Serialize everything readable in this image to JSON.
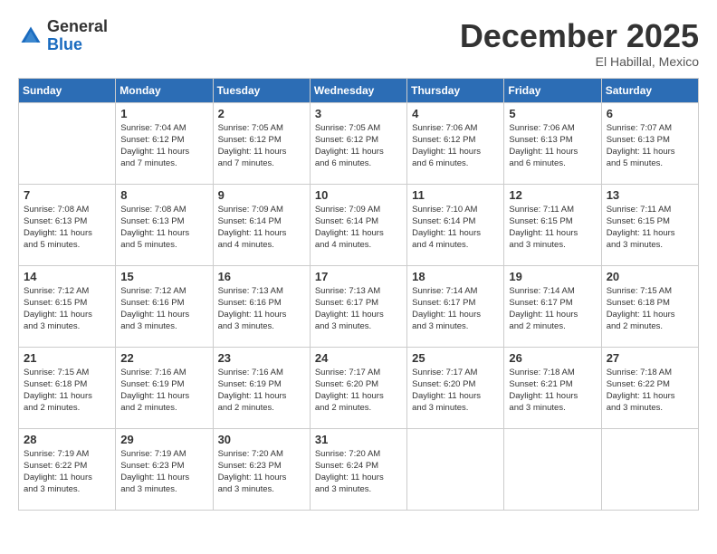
{
  "logo": {
    "general": "General",
    "blue": "Blue"
  },
  "title": "December 2025",
  "location": "El Habillal, Mexico",
  "days": [
    "Sunday",
    "Monday",
    "Tuesday",
    "Wednesday",
    "Thursday",
    "Friday",
    "Saturday"
  ],
  "weeks": [
    [
      {
        "num": "",
        "info": ""
      },
      {
        "num": "1",
        "info": "Sunrise: 7:04 AM\nSunset: 6:12 PM\nDaylight: 11 hours\nand 7 minutes."
      },
      {
        "num": "2",
        "info": "Sunrise: 7:05 AM\nSunset: 6:12 PM\nDaylight: 11 hours\nand 7 minutes."
      },
      {
        "num": "3",
        "info": "Sunrise: 7:05 AM\nSunset: 6:12 PM\nDaylight: 11 hours\nand 6 minutes."
      },
      {
        "num": "4",
        "info": "Sunrise: 7:06 AM\nSunset: 6:12 PM\nDaylight: 11 hours\nand 6 minutes."
      },
      {
        "num": "5",
        "info": "Sunrise: 7:06 AM\nSunset: 6:13 PM\nDaylight: 11 hours\nand 6 minutes."
      },
      {
        "num": "6",
        "info": "Sunrise: 7:07 AM\nSunset: 6:13 PM\nDaylight: 11 hours\nand 5 minutes."
      }
    ],
    [
      {
        "num": "7",
        "info": "Sunrise: 7:08 AM\nSunset: 6:13 PM\nDaylight: 11 hours\nand 5 minutes."
      },
      {
        "num": "8",
        "info": "Sunrise: 7:08 AM\nSunset: 6:13 PM\nDaylight: 11 hours\nand 5 minutes."
      },
      {
        "num": "9",
        "info": "Sunrise: 7:09 AM\nSunset: 6:14 PM\nDaylight: 11 hours\nand 4 minutes."
      },
      {
        "num": "10",
        "info": "Sunrise: 7:09 AM\nSunset: 6:14 PM\nDaylight: 11 hours\nand 4 minutes."
      },
      {
        "num": "11",
        "info": "Sunrise: 7:10 AM\nSunset: 6:14 PM\nDaylight: 11 hours\nand 4 minutes."
      },
      {
        "num": "12",
        "info": "Sunrise: 7:11 AM\nSunset: 6:15 PM\nDaylight: 11 hours\nand 3 minutes."
      },
      {
        "num": "13",
        "info": "Sunrise: 7:11 AM\nSunset: 6:15 PM\nDaylight: 11 hours\nand 3 minutes."
      }
    ],
    [
      {
        "num": "14",
        "info": "Sunrise: 7:12 AM\nSunset: 6:15 PM\nDaylight: 11 hours\nand 3 minutes."
      },
      {
        "num": "15",
        "info": "Sunrise: 7:12 AM\nSunset: 6:16 PM\nDaylight: 11 hours\nand 3 minutes."
      },
      {
        "num": "16",
        "info": "Sunrise: 7:13 AM\nSunset: 6:16 PM\nDaylight: 11 hours\nand 3 minutes."
      },
      {
        "num": "17",
        "info": "Sunrise: 7:13 AM\nSunset: 6:17 PM\nDaylight: 11 hours\nand 3 minutes."
      },
      {
        "num": "18",
        "info": "Sunrise: 7:14 AM\nSunset: 6:17 PM\nDaylight: 11 hours\nand 3 minutes."
      },
      {
        "num": "19",
        "info": "Sunrise: 7:14 AM\nSunset: 6:17 PM\nDaylight: 11 hours\nand 2 minutes."
      },
      {
        "num": "20",
        "info": "Sunrise: 7:15 AM\nSunset: 6:18 PM\nDaylight: 11 hours\nand 2 minutes."
      }
    ],
    [
      {
        "num": "21",
        "info": "Sunrise: 7:15 AM\nSunset: 6:18 PM\nDaylight: 11 hours\nand 2 minutes."
      },
      {
        "num": "22",
        "info": "Sunrise: 7:16 AM\nSunset: 6:19 PM\nDaylight: 11 hours\nand 2 minutes."
      },
      {
        "num": "23",
        "info": "Sunrise: 7:16 AM\nSunset: 6:19 PM\nDaylight: 11 hours\nand 2 minutes."
      },
      {
        "num": "24",
        "info": "Sunrise: 7:17 AM\nSunset: 6:20 PM\nDaylight: 11 hours\nand 2 minutes."
      },
      {
        "num": "25",
        "info": "Sunrise: 7:17 AM\nSunset: 6:20 PM\nDaylight: 11 hours\nand 3 minutes."
      },
      {
        "num": "26",
        "info": "Sunrise: 7:18 AM\nSunset: 6:21 PM\nDaylight: 11 hours\nand 3 minutes."
      },
      {
        "num": "27",
        "info": "Sunrise: 7:18 AM\nSunset: 6:22 PM\nDaylight: 11 hours\nand 3 minutes."
      }
    ],
    [
      {
        "num": "28",
        "info": "Sunrise: 7:19 AM\nSunset: 6:22 PM\nDaylight: 11 hours\nand 3 minutes."
      },
      {
        "num": "29",
        "info": "Sunrise: 7:19 AM\nSunset: 6:23 PM\nDaylight: 11 hours\nand 3 minutes."
      },
      {
        "num": "30",
        "info": "Sunrise: 7:20 AM\nSunset: 6:23 PM\nDaylight: 11 hours\nand 3 minutes."
      },
      {
        "num": "31",
        "info": "Sunrise: 7:20 AM\nSunset: 6:24 PM\nDaylight: 11 hours\nand 3 minutes."
      },
      {
        "num": "",
        "info": ""
      },
      {
        "num": "",
        "info": ""
      },
      {
        "num": "",
        "info": ""
      }
    ]
  ]
}
